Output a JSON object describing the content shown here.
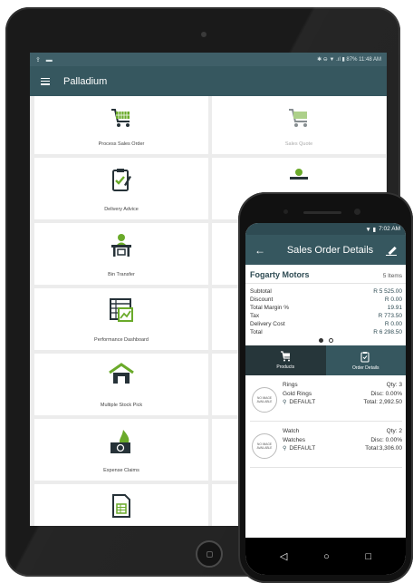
{
  "tablet": {
    "status_left": "⇪ ▬",
    "status_right": "✱ ⊖ ▼ .ıl ▮ 87% 11:48 AM",
    "app_title": "Palladium",
    "tiles": [
      {
        "label": "Process Sales Order",
        "icon": "cart-icon"
      },
      {
        "label": "Sales Quote",
        "icon": "cart-icon"
      },
      {
        "label": "Delivery Advice",
        "icon": "clipboard-icon"
      },
      {
        "label": "",
        "icon": "person-desk-icon"
      },
      {
        "label": "Bin Transfer",
        "icon": "person-desk-icon"
      },
      {
        "label": "",
        "icon": ""
      },
      {
        "label": "Performance Dashboard",
        "icon": "dashboard-icon"
      },
      {
        "label": "",
        "icon": ""
      },
      {
        "label": "Multiple Stock Pick",
        "icon": "warehouse-icon"
      },
      {
        "label": "",
        "icon": ""
      },
      {
        "label": "Expense Claims",
        "icon": "money-fire-icon"
      },
      {
        "label": "",
        "icon": ""
      },
      {
        "label": "",
        "icon": "report-icon"
      },
      {
        "label": "",
        "icon": ""
      }
    ]
  },
  "phone": {
    "status_time": "7:02 AM",
    "status_icons": "▼ ▮",
    "title": "Sales Order Details",
    "customer_name": "Fogarty Motors",
    "item_count": "5 Items",
    "summary": [
      {
        "label": "Subtotal",
        "value": "R 5 525.00"
      },
      {
        "label": "Discount",
        "value": "R 0.00"
      },
      {
        "label": "Total Margin %",
        "value": "19.91"
      },
      {
        "label": "Tax",
        "value": "R 773.50"
      },
      {
        "label": "Delivery Cost",
        "value": "R 0.00"
      },
      {
        "label": "Total",
        "value": "R 6 298.50"
      }
    ],
    "tabs": [
      {
        "label": "Products",
        "icon": "cart-icon"
      },
      {
        "label": "Order Details",
        "icon": "clipboard-icon"
      }
    ],
    "items": [
      {
        "image_text": "NO IMAGE AVAILABLE",
        "name": "Rings",
        "qty": "Qty: 3",
        "category": "Gold Rings",
        "disc": "Disc: 0.00%",
        "warehouse": "DEFAULT",
        "total": "Total: 2,992.50"
      },
      {
        "image_text": "NO IMAGE AVAILABLE",
        "name": "Watch",
        "qty": "Qty: 2",
        "category": "Watches",
        "disc": "Disc: 0.00%",
        "warehouse": "DEFAULT",
        "total": "Total:3,306.00"
      }
    ],
    "nav": {
      "back": "◁",
      "home": "○",
      "recents": "□"
    }
  },
  "colors": {
    "appbar": "#36575f",
    "status": "#2e4b53",
    "icon_green": "#6aaa2a",
    "icon_dark": "#263238"
  }
}
